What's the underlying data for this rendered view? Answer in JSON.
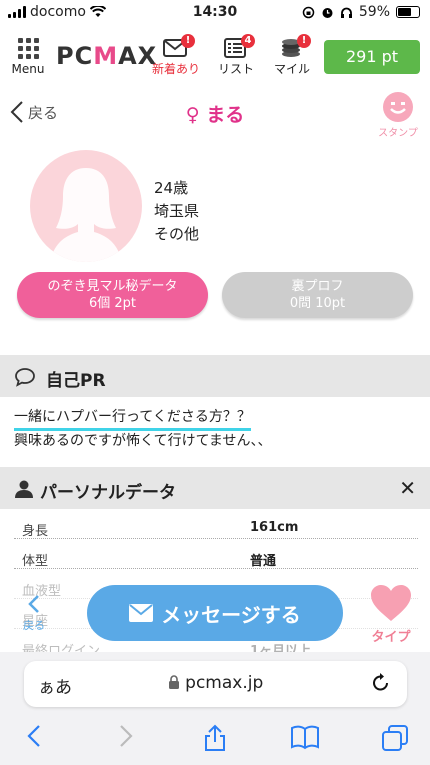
{
  "status": {
    "carrier": "docomo",
    "time": "14:30",
    "battery": "59%"
  },
  "header": {
    "menu_label": "Menu",
    "logo_text_1": "PC",
    "logo_text_2": "M",
    "logo_text_3": "AX",
    "nav": [
      {
        "label": "新着あり",
        "badge": "!"
      },
      {
        "label": "リスト",
        "badge": "4"
      },
      {
        "label": "マイル",
        "badge": "!"
      }
    ],
    "points": "291 pt"
  },
  "title": {
    "back": "戻る",
    "name": "♀ まる",
    "stamp": "スタンプ"
  },
  "profile": {
    "age": "24歳",
    "region": "埼玉県",
    "other": "その他",
    "secret_btn_line1": "のぞき見マル秘データ",
    "secret_btn_line2": "6個 2pt",
    "ura_btn_line1": "裏プロフ",
    "ura_btn_line2": "0問 10pt"
  },
  "pr": {
    "heading": "自己PR",
    "line1": "一緒にハプバー行ってくださる方？？",
    "line2": "興味あるのですが怖くて行けてません、、"
  },
  "personal": {
    "heading": "パーソナルデータ",
    "close": "✕",
    "rows": [
      {
        "key": "身長",
        "value": "161cm"
      },
      {
        "key": "体型",
        "value": "普通"
      },
      {
        "key": "血液型",
        "value": ""
      },
      {
        "key": "星座",
        "value": ""
      },
      {
        "key": "最終ログイン",
        "value": "1ヶ月以上"
      }
    ]
  },
  "floating": {
    "back": "戻る",
    "message": "メッセージする",
    "type": "タイプ"
  },
  "safari": {
    "aa": "ぁあ",
    "host": "pcmax.jp"
  },
  "colors": {
    "pink": "#e0328a",
    "green": "#5db84a",
    "blue": "#5aa9e6",
    "accent": "#3fd3e8"
  }
}
